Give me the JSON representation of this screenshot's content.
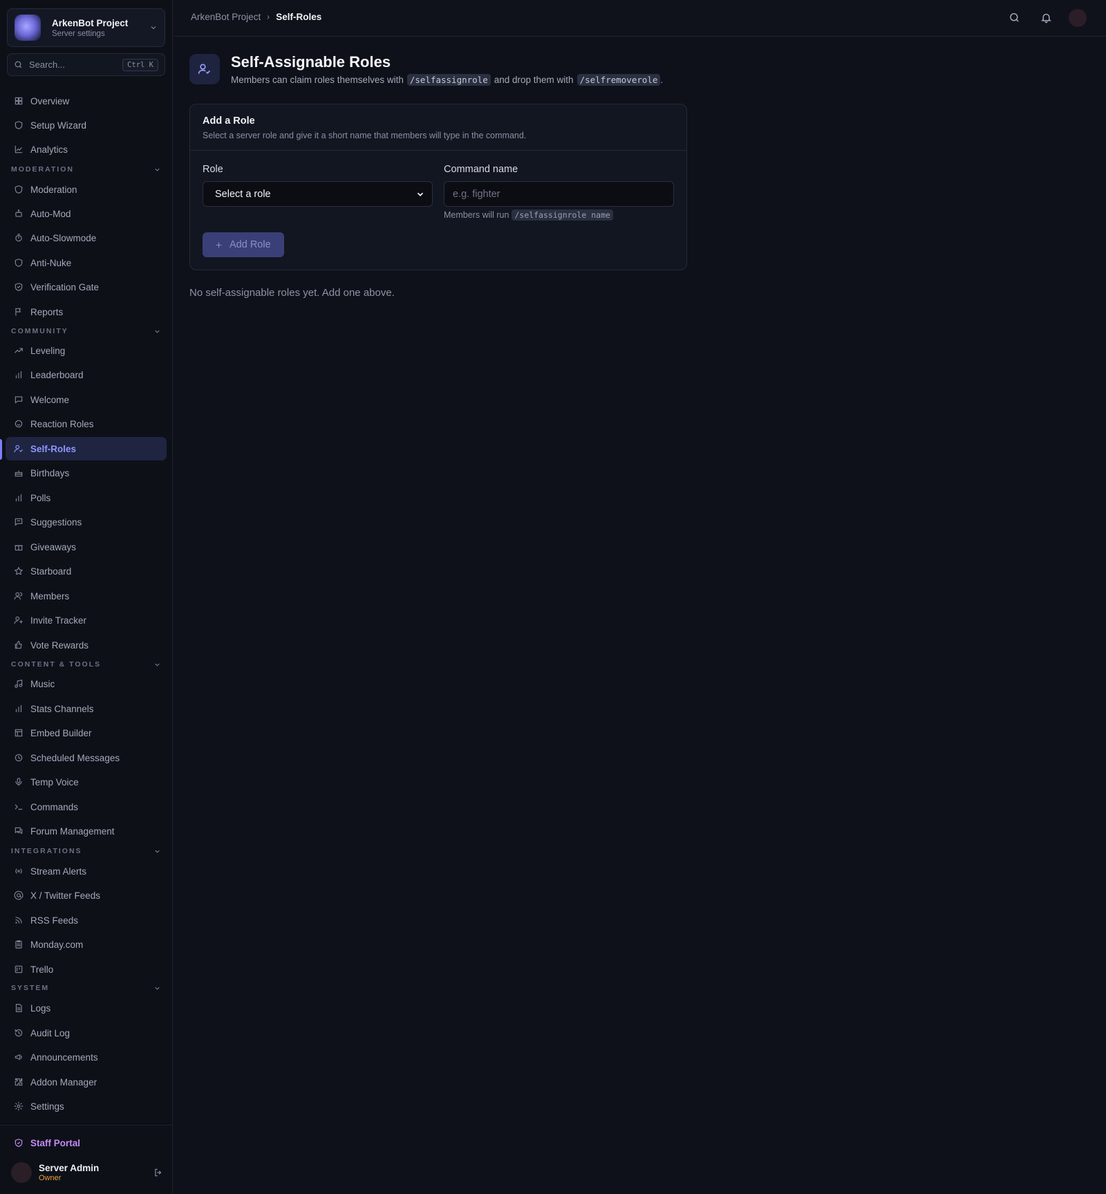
{
  "sidebar": {
    "server_name": "ArkenBot Project",
    "server_sub": "Server settings",
    "search_placeholder": "Search...",
    "search_shortcut": "Ctrl K",
    "items": [
      {
        "label": "Overview",
        "icon": "grid-icon"
      },
      {
        "label": "Setup Wizard",
        "icon": "shield-icon"
      },
      {
        "label": "Analytics",
        "icon": "chart-line-icon"
      },
      {
        "label": "Moderation",
        "icon": "shield-icon"
      },
      {
        "label": "Auto-Mod",
        "icon": "bot-icon"
      },
      {
        "label": "Auto-Slowmode",
        "icon": "timer-icon"
      },
      {
        "label": "Anti-Nuke",
        "icon": "shield-icon"
      },
      {
        "label": "Verification Gate",
        "icon": "shield-check-icon"
      },
      {
        "label": "Reports",
        "icon": "flag-icon"
      },
      {
        "label": "Leveling",
        "icon": "trending-up-icon"
      },
      {
        "label": "Leaderboard",
        "icon": "bar-chart-icon"
      },
      {
        "label": "Welcome",
        "icon": "message-icon"
      },
      {
        "label": "Reaction Roles",
        "icon": "smile-icon"
      },
      {
        "label": "Self-Roles",
        "icon": "user-check-icon"
      },
      {
        "label": "Birthdays",
        "icon": "cake-icon"
      },
      {
        "label": "Polls",
        "icon": "bar-chart-icon"
      },
      {
        "label": "Suggestions",
        "icon": "message-square-icon"
      },
      {
        "label": "Giveaways",
        "icon": "gift-icon"
      },
      {
        "label": "Starboard",
        "icon": "star-icon"
      },
      {
        "label": "Members",
        "icon": "users-icon"
      },
      {
        "label": "Invite Tracker",
        "icon": "user-plus-icon"
      },
      {
        "label": "Vote Rewards",
        "icon": "thumbs-up-icon"
      },
      {
        "label": "Music",
        "icon": "music-icon"
      },
      {
        "label": "Stats Channels",
        "icon": "bar-chart-icon"
      },
      {
        "label": "Embed Builder",
        "icon": "layout-icon"
      },
      {
        "label": "Scheduled Messages",
        "icon": "clock-icon"
      },
      {
        "label": "Temp Voice",
        "icon": "mic-icon"
      },
      {
        "label": "Commands",
        "icon": "terminal-icon"
      },
      {
        "label": "Forum Management",
        "icon": "messages-icon"
      },
      {
        "label": "Stream Alerts",
        "icon": "radio-icon"
      },
      {
        "label": "X / Twitter Feeds",
        "icon": "at-sign-icon"
      },
      {
        "label": "RSS Feeds",
        "icon": "rss-icon"
      },
      {
        "label": "Monday.com",
        "icon": "clipboard-icon"
      },
      {
        "label": "Trello",
        "icon": "trello-icon"
      },
      {
        "label": "Logs",
        "icon": "file-text-icon"
      },
      {
        "label": "Audit Log",
        "icon": "history-icon"
      },
      {
        "label": "Announcements",
        "icon": "megaphone-icon"
      },
      {
        "label": "Addon Manager",
        "icon": "puzzle-icon"
      },
      {
        "label": "Settings",
        "icon": "gear-icon"
      }
    ],
    "sections": [
      "MODERATION",
      "COMMUNITY",
      "CONTENT & TOOLS",
      "INTEGRATIONS",
      "SYSTEM"
    ],
    "staff_portal": "Staff Portal",
    "user_name": "Server Admin",
    "user_role": "Owner"
  },
  "header": {
    "crumb_parent": "ArkenBot Project",
    "crumb_current": "Self-Roles"
  },
  "main": {
    "title": "Self-Assignable Roles",
    "desc_pre": "Members can claim roles themselves with",
    "cmd_assign": "/selfassignrole",
    "desc_mid": "and drop them with",
    "cmd_remove": "/selfremoverole",
    "desc_end": ".",
    "card_title": "Add a Role",
    "card_sub": "Select a server role and give it a short name that members will type in the command.",
    "role_label": "Role",
    "role_value": "Select a role",
    "cmd_label": "Command name",
    "cmd_placeholder": "e.g. fighter",
    "hint_pre": "Members will run",
    "hint_code": "/selfassignrole name",
    "add_button": "Add Role",
    "empty_text": "No self-assignable roles yet. Add one above."
  },
  "colors": {
    "accent": "#8f96ff",
    "staff_portal": "#c58cf5",
    "owner_badge": "#e9a23b",
    "background": "#0e1119"
  }
}
